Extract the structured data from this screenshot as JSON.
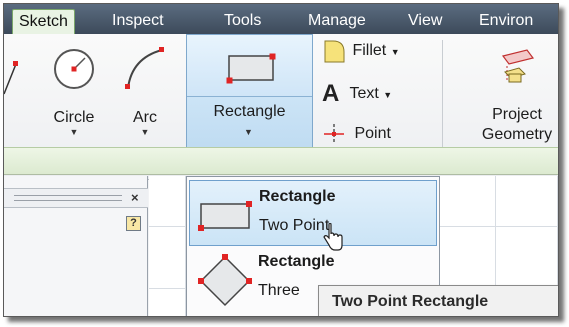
{
  "tabs": [
    {
      "label": "Sketch",
      "active": true
    },
    {
      "label": "Inspect",
      "active": false
    },
    {
      "label": "Tools",
      "active": false
    },
    {
      "label": "Manage",
      "active": false
    },
    {
      "label": "View",
      "active": false
    },
    {
      "label": "Environ",
      "active": false
    }
  ],
  "ribbon": {
    "circle_label": "Circle",
    "arc_label": "Arc",
    "rectangle_label": "Rectangle",
    "fillet_label": "Fillet",
    "text_label": "Text",
    "point_label": "Point",
    "project_geometry_label_1": "Project",
    "project_geometry_label_2": "Geometry"
  },
  "browser": {
    "close_symbol": "×",
    "help_symbol": "?"
  },
  "dropdown": {
    "items": [
      {
        "title": "Rectangle",
        "subtitle": "Two Point",
        "highlighted": true
      },
      {
        "title": "Rectangle",
        "subtitle": "Three",
        "highlighted": false
      }
    ]
  },
  "tooltip": {
    "text": "Two Point Rectangle"
  },
  "colors": {
    "accent_red": "#e02424",
    "highlight_blue": "#cbe4f6",
    "tab_bar": "#4a5868",
    "active_tab": "#e9f3e4"
  }
}
